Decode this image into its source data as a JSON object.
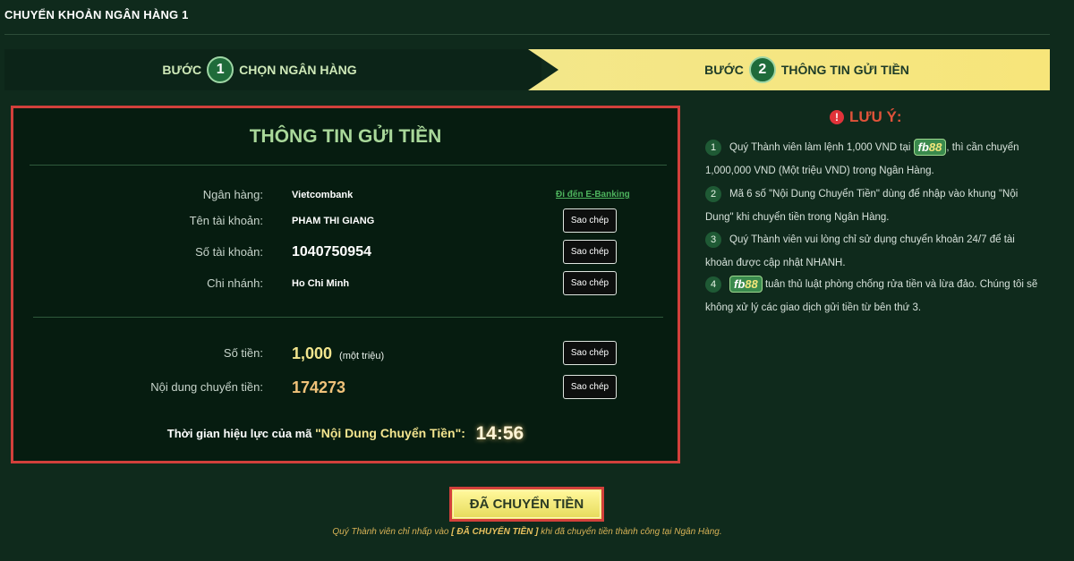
{
  "page": {
    "title": "CHUYỂN KHOẢN NGÂN HÀNG 1"
  },
  "steps": [
    {
      "prefix": "BƯỚC",
      "number": "1",
      "label": "CHỌN NGÂN HÀNG",
      "active": false
    },
    {
      "prefix": "BƯỚC",
      "number": "2",
      "label": "THÔNG TIN GỬI TIỀN",
      "active": true
    }
  ],
  "panel": {
    "heading": "THÔNG TIN GỬI TIỀN",
    "bank": {
      "label": "Ngân hàng:",
      "value": "Vietcombank",
      "link": "Đi đến E-Banking"
    },
    "account_name": {
      "label": "Tên tài khoản:",
      "value": "PHAM THI GIANG"
    },
    "account_number": {
      "label": "Số tài khoản:",
      "value": "1040750954"
    },
    "branch": {
      "label": "Chi nhánh:",
      "value": "Ho Chi Minh"
    },
    "amount": {
      "label": "Số tiền:",
      "value": "1,000",
      "unit": "(một triệu)"
    },
    "transfer_content": {
      "label": "Nội dung chuyển tiền:",
      "value": "174273"
    },
    "copy_label": "Sao chép",
    "timer": {
      "prefix": "Thời gian hiệu lực của mã",
      "quoted": "\"Nội Dung Chuyển Tiền\":",
      "time": "14:56"
    }
  },
  "notes": {
    "title": "LƯU Ý:",
    "brand": {
      "part1": "fb",
      "part2": "88"
    },
    "items": [
      {
        "number": "1",
        "text_before": "Quý Thành viên làm lệnh 1,000 VND tại",
        "text_after": ", thì cần chuyển 1,000,000 VND (Một triệu VND) trong Ngân Hàng."
      },
      {
        "number": "2",
        "text": "Mã 6 số \"Nội Dung Chuyển Tiền\" dùng để nhập vào khung \"Nội Dung\" khi chuyển tiền trong Ngân Hàng."
      },
      {
        "number": "3",
        "text": "Quý Thành viên vui lòng chỉ sử dụng chuyển khoản 24/7 để tài khoản được cập nhật NHANH."
      },
      {
        "number": "4",
        "text_after": " tuân thủ luật phòng chống rửa tiền và lừa đảo. Chúng tôi sẽ không xử lý các giao dịch gửi tiền từ bên thứ 3."
      }
    ]
  },
  "confirm": {
    "button_label": "ĐÃ CHUYỂN TIỀN",
    "footnote_before": "Quý Thành viên chỉ nhấp vào",
    "footnote_bold": "[ ĐÃ CHUYỂN TIỀN ]",
    "footnote_after": "khi đã chuyển tiền thành công tại Ngân Hàng."
  },
  "colors": {
    "background": "#0f2a1c",
    "panel_border": "#d2403b",
    "accent_yellow": "#f2ea7a",
    "heading_green": "#a9d89a"
  }
}
